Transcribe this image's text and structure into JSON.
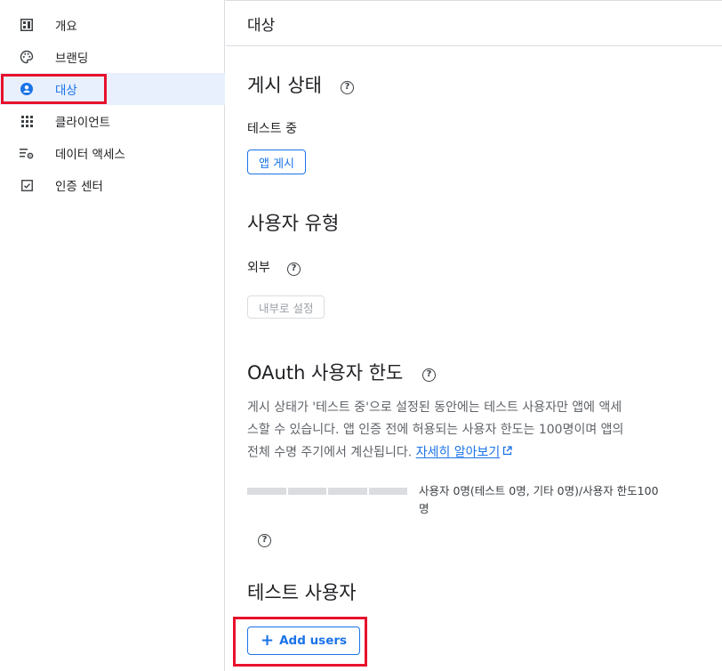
{
  "sidebar": {
    "items": [
      {
        "label": "개요",
        "icon": "dashboard-icon"
      },
      {
        "label": "브랜딩",
        "icon": "palette-icon"
      },
      {
        "label": "대상",
        "icon": "person-circle-icon"
      },
      {
        "label": "클라이언트",
        "icon": "apps-grid-icon"
      },
      {
        "label": "데이터 액세스",
        "icon": "data-settings-icon"
      },
      {
        "label": "인증 센터",
        "icon": "checkbox-icon"
      }
    ]
  },
  "header": {
    "title": "대상"
  },
  "publish": {
    "heading": "게시 상태",
    "status": "테스트 중",
    "button": "앱 게시"
  },
  "user_type": {
    "heading": "사용자 유형",
    "value": "외부",
    "button": "내부로 설정"
  },
  "oauth_limit": {
    "heading": "OAuth 사용자 한도",
    "paragraph_line1": "게시 상태가 '테스트 중'으로 설정된 동안에는 테스트 사용자만 앱에 액세",
    "paragraph_line2": "스할 수 있습니다. 앱 인증 전에 허용되는 사용자 한도는 100명이며 앱의",
    "paragraph_line3": "전체 수명 주기에서 계산됩니다.",
    "learn_more": "자세히 알아보기",
    "usage_line1": "사용자 0명(테스트 0명, 기타 0명)/사용자 한도100",
    "usage_line2": "명",
    "usage_fraction": 0
  },
  "test_users": {
    "heading": "테스트 사용자",
    "add_button": "Add users"
  },
  "colors": {
    "accent": "#1a73e8",
    "highlight": "#e8112d",
    "active_bg": "#e8f0fe"
  }
}
